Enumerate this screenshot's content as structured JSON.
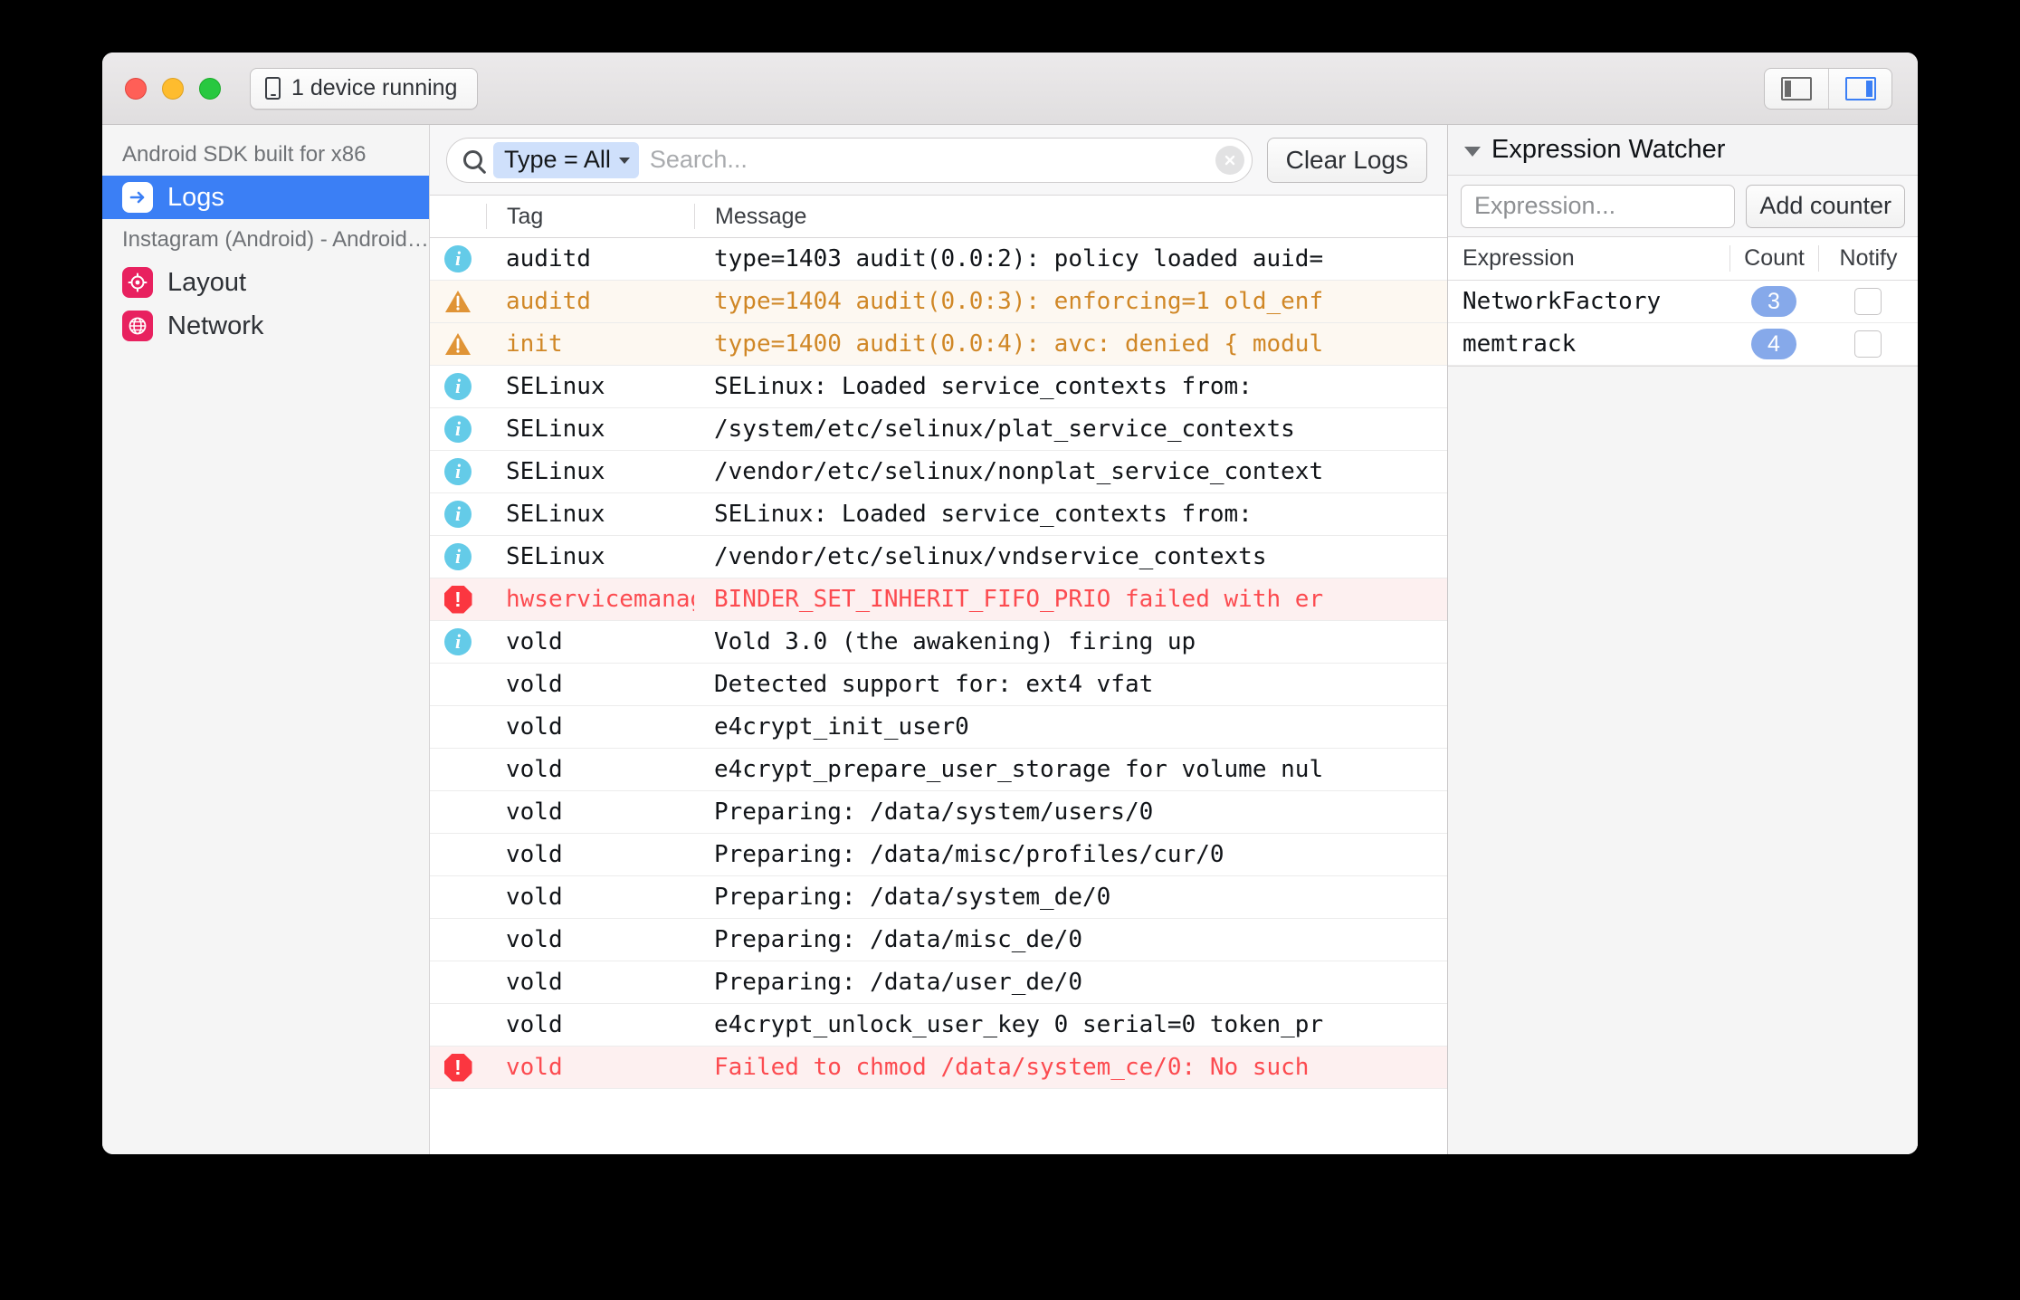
{
  "titlebar": {
    "device_label": "1 device running",
    "phone_icon": "phone-icon",
    "left_panel_icon": "left-panel-toggle-icon",
    "right_panel_icon": "right-panel-toggle-icon"
  },
  "sidebar": {
    "group1_header": "Android SDK built for x86",
    "group2_header": "Instagram (Android) - Android S...",
    "items": [
      {
        "label": "Logs",
        "icon": "arrow-right-icon",
        "active": true
      },
      {
        "label": "Layout",
        "icon": "target-icon",
        "active": false
      },
      {
        "label": "Network",
        "icon": "globe-icon",
        "active": false
      }
    ]
  },
  "toolbar": {
    "search_icon": "search-icon",
    "filter_token": "Type = All",
    "search_placeholder": "Search...",
    "clear_input_icon": "clear-input-icon",
    "clear_logs_label": "Clear Logs"
  },
  "log_table": {
    "columns": [
      "",
      "Tag",
      "Message"
    ],
    "rows": [
      {
        "level": "info",
        "tag": "auditd",
        "message": "type=1403 audit(0.0:2): policy loaded auid="
      },
      {
        "level": "warn",
        "tag": "auditd",
        "message": "type=1404 audit(0.0:3): enforcing=1 old_enf"
      },
      {
        "level": "warn",
        "tag": "init",
        "message": "type=1400 audit(0.0:4): avc: denied { modul"
      },
      {
        "level": "info",
        "tag": "SELinux",
        "message": "SELinux: Loaded service_contexts from:"
      },
      {
        "level": "info",
        "tag": "SELinux",
        "message": "/system/etc/selinux/plat_service_contexts"
      },
      {
        "level": "info",
        "tag": "SELinux",
        "message": "/vendor/etc/selinux/nonplat_service_context"
      },
      {
        "level": "info",
        "tag": "SELinux",
        "message": "SELinux: Loaded service_contexts from:"
      },
      {
        "level": "info",
        "tag": "SELinux",
        "message": "/vendor/etc/selinux/vndservice_contexts"
      },
      {
        "level": "error",
        "tag": "hwservicemanag",
        "message": "BINDER_SET_INHERIT_FIFO_PRIO failed with er"
      },
      {
        "level": "info",
        "tag": "vold",
        "message": "Vold 3.0 (the awakening) firing up"
      },
      {
        "level": "none",
        "tag": "vold",
        "message": "Detected support for: ext4 vfat"
      },
      {
        "level": "none",
        "tag": "vold",
        "message": "e4crypt_init_user0"
      },
      {
        "level": "none",
        "tag": "vold",
        "message": "e4crypt_prepare_user_storage for volume nul"
      },
      {
        "level": "none",
        "tag": "vold",
        "message": "Preparing: /data/system/users/0"
      },
      {
        "level": "none",
        "tag": "vold",
        "message": "Preparing: /data/misc/profiles/cur/0"
      },
      {
        "level": "none",
        "tag": "vold",
        "message": "Preparing: /data/system_de/0"
      },
      {
        "level": "none",
        "tag": "vold",
        "message": "Preparing: /data/misc_de/0"
      },
      {
        "level": "none",
        "tag": "vold",
        "message": "Preparing: /data/user_de/0"
      },
      {
        "level": "none",
        "tag": "vold",
        "message": "e4crypt_unlock_user_key 0 serial=0 token_pr"
      },
      {
        "level": "error",
        "tag": "vold",
        "message": "Failed to chmod /data/system_ce/0: No such"
      }
    ]
  },
  "expression_watcher": {
    "title": "Expression Watcher",
    "collapse_icon": "triangle-down-icon",
    "expression_placeholder": "Expression...",
    "add_counter_label": "Add counter",
    "columns": {
      "expression": "Expression",
      "count": "Count",
      "notify": "Notify"
    },
    "rows": [
      {
        "expression": "NetworkFactory",
        "count": "3",
        "notify": false
      },
      {
        "expression": "memtrack",
        "count": "4",
        "notify": false
      }
    ]
  },
  "colors": {
    "accent_blue": "#3b7ff5",
    "sidebar_pink": "#e8215f",
    "warn_text": "#d08726",
    "warn_bg": "#fdf8f1",
    "error_text": "#fc4b50",
    "error_bg": "#fdf0f0",
    "info_icon": "#64cbe8",
    "badge_blue": "#86a9ea",
    "filter_token_bg": "#cfe0fb"
  }
}
